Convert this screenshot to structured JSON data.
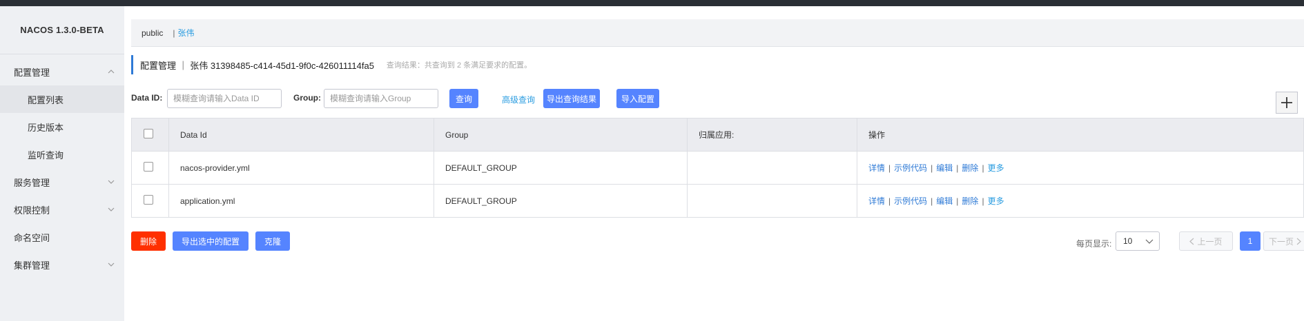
{
  "brand": "NACOS 1.3.0-BETA",
  "sidebar": {
    "config_group": "配置管理",
    "config_items": [
      "配置列表",
      "历史版本",
      "监听查询"
    ],
    "service_group": "服务管理",
    "auth_group": "权限控制",
    "namespace_item": "命名空间",
    "cluster_group": "集群管理"
  },
  "namespace_bar": {
    "public": "public",
    "sep": "|",
    "current": "张伟"
  },
  "title": {
    "main": "配置管理 ｜ 张伟  31398485-c414-45d1-9f0c-426011114fa5",
    "hint": "查询结果：共查询到 2 条满足要求的配置。"
  },
  "search": {
    "dataid_label": "Data ID:",
    "dataid_placeholder": "模糊查询请输入Data ID",
    "group_label": "Group:",
    "group_placeholder": "模糊查询请输入Group",
    "query_button": "查询",
    "advanced_link": "高级查询",
    "export_button": "导出查询结果",
    "import_button": "导入配置"
  },
  "table": {
    "headers": [
      "Data Id",
      "Group",
      "归属应用:",
      "操作"
    ],
    "rows": [
      {
        "data_id": "nacos-provider.yml",
        "group": "DEFAULT_GROUP",
        "app": ""
      },
      {
        "data_id": "application.yml",
        "group": "DEFAULT_GROUP",
        "app": ""
      }
    ],
    "ops": {
      "detail": "详情",
      "sample": "示例代码",
      "edit": "编辑",
      "delete": "删除",
      "more": "更多",
      "sep": "|"
    }
  },
  "footer": {
    "delete_button": "删除",
    "export_selected_button": "导出选中的配置",
    "clone_button": "克隆",
    "page_size_label": "每页显示:",
    "page_size": "10",
    "prev": "上一页",
    "current_page": "1",
    "next": "下一页"
  },
  "colors": {
    "primary": "#5584ff",
    "danger": "#ff3000",
    "link": "#2a9ce0",
    "sidebar_bg": "#eef0f3"
  }
}
